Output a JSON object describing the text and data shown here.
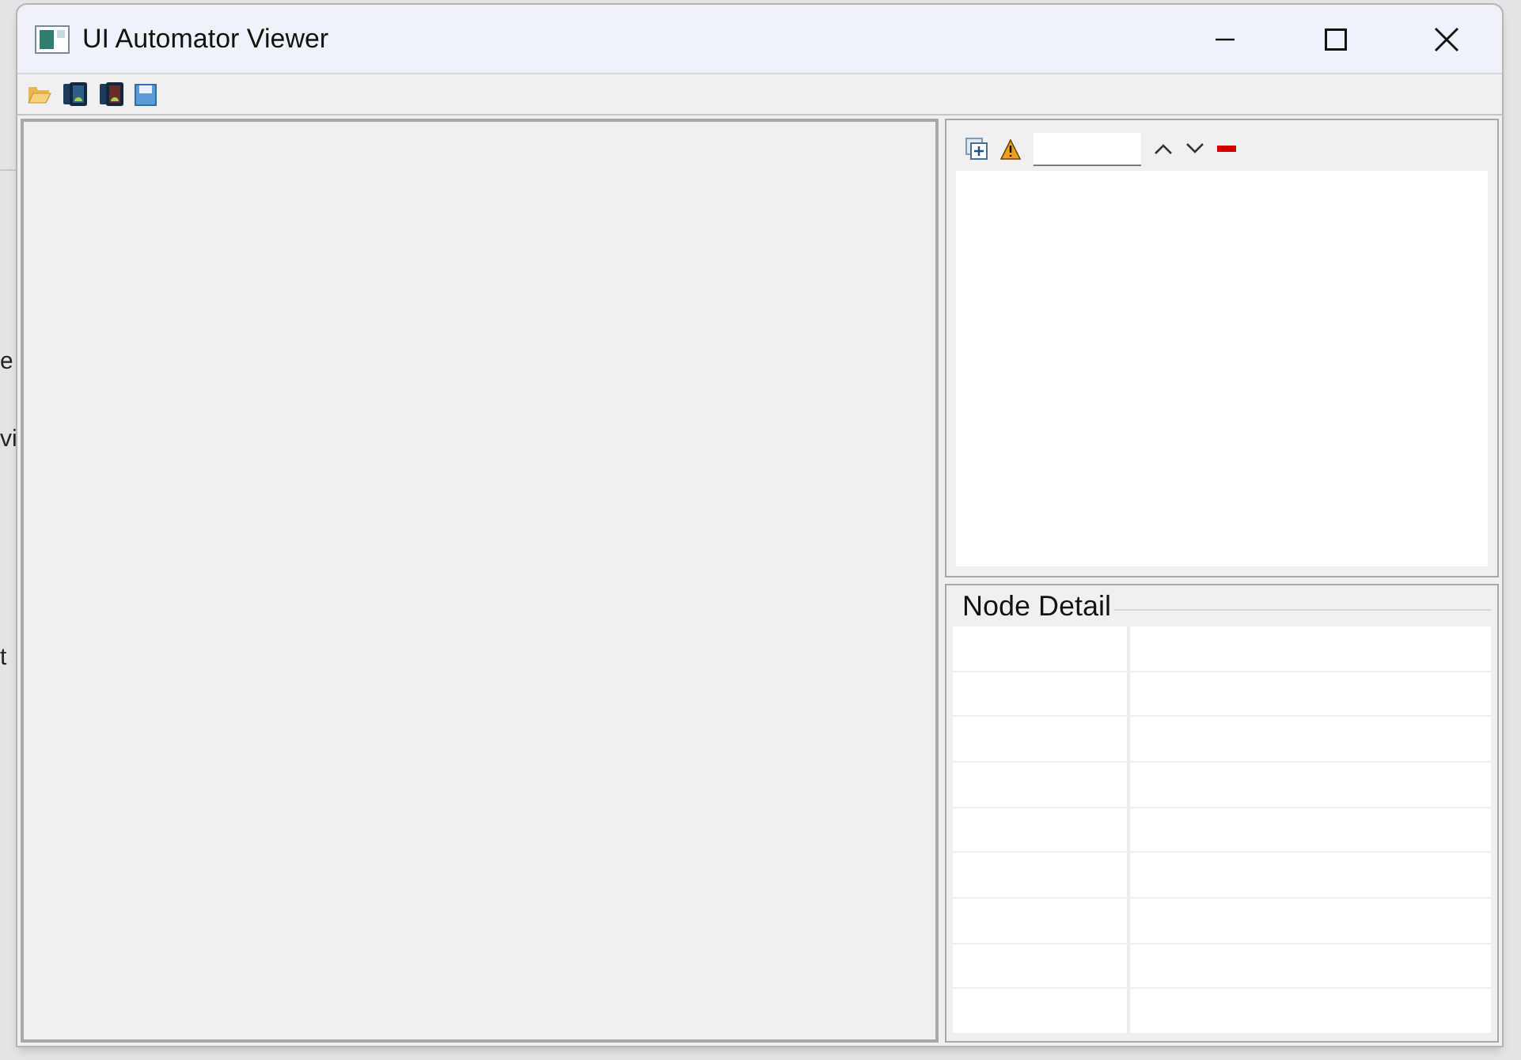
{
  "background_window": {
    "texts": [
      "e",
      "vi",
      "t"
    ]
  },
  "window": {
    "title": "UI Automator Viewer"
  },
  "toolbar": {
    "items": [
      {
        "kind": "folder"
      },
      {
        "kind": "device"
      },
      {
        "kind": "device_compressed"
      },
      {
        "kind": "save"
      }
    ]
  },
  "tree_panel": {
    "toolbar": [
      {
        "kind": "expand"
      },
      {
        "kind": "warning"
      },
      {
        "kind": "search"
      },
      {
        "kind": "up"
      },
      {
        "kind": "down"
      },
      {
        "kind": "clear"
      }
    ]
  },
  "node_detail": {
    "title": "Node Detail"
  }
}
